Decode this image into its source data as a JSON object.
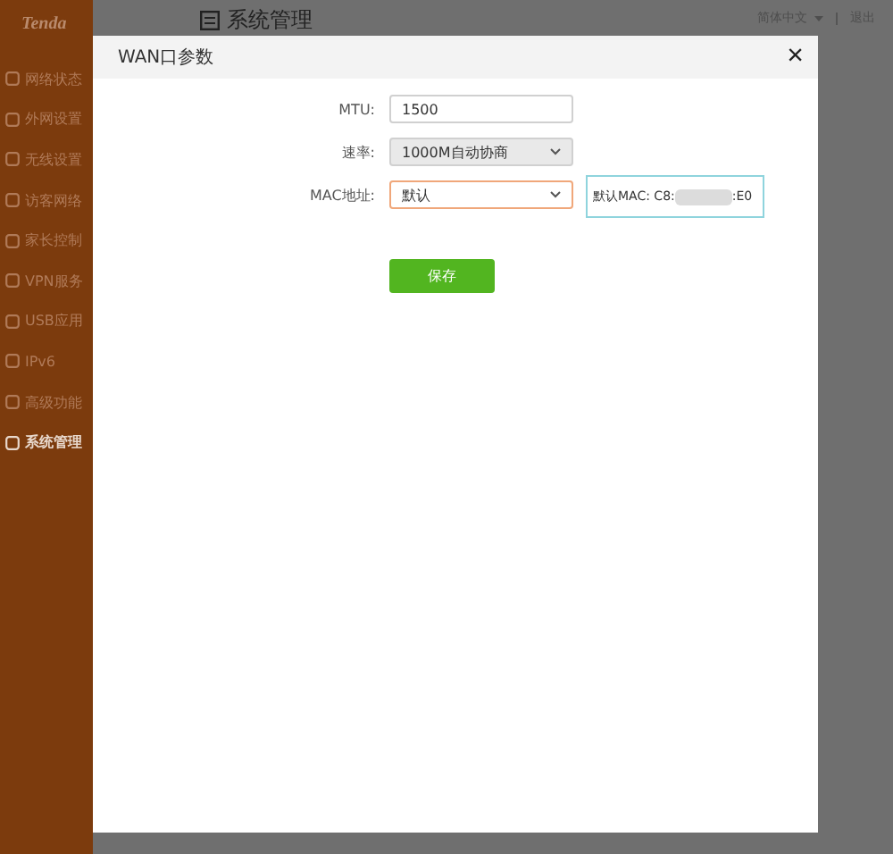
{
  "logo": "Tenda",
  "sidebar": {
    "items": [
      {
        "label": "网络状态",
        "selected": false
      },
      {
        "label": "外网设置",
        "selected": false
      },
      {
        "label": "无线设置",
        "selected": false
      },
      {
        "label": "访客网络",
        "selected": false
      },
      {
        "label": "家长控制",
        "selected": false
      },
      {
        "label": "VPN服务",
        "selected": false
      },
      {
        "label": "USB应用",
        "selected": false
      },
      {
        "label": "IPv6",
        "selected": false
      },
      {
        "label": "高级功能",
        "selected": false
      },
      {
        "label": "系统管理",
        "selected": true
      }
    ]
  },
  "header": {
    "title": "系统管理",
    "language": "简体中文",
    "logout": "退出"
  },
  "dialog": {
    "title": "WAN口参数",
    "close": "×",
    "fields": [
      {
        "kind": "input",
        "label": "MTU:",
        "value": "1500"
      },
      {
        "kind": "select",
        "label": "速率:",
        "value": "1000M自动协商",
        "disabled": true,
        "focused": false
      },
      {
        "kind": "select",
        "label": "MAC地址:",
        "value": "默认",
        "disabled": false,
        "focused": true,
        "tip": {
          "prefix": "默认MAC: C8:",
          "suffix": ":E0"
        }
      }
    ],
    "save": "保存"
  }
}
